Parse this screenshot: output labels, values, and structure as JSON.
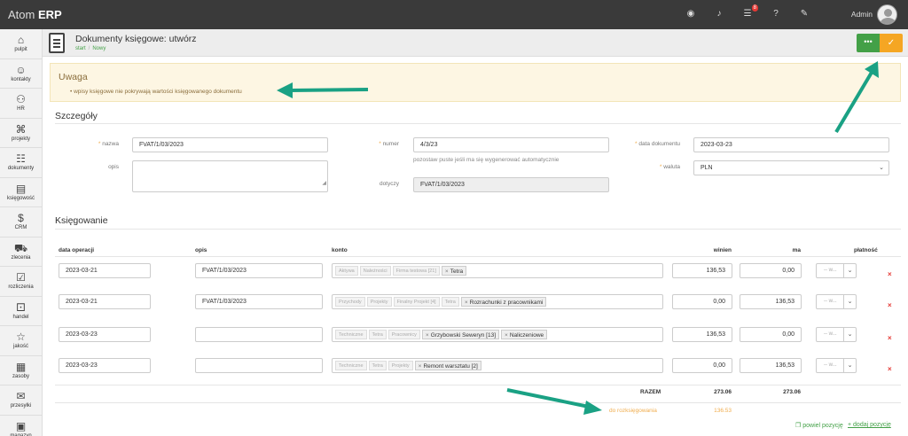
{
  "app": {
    "brand_light": "Atom",
    "brand_bold": "ERP",
    "user": "Admin",
    "notification_count": "8"
  },
  "header": {
    "title": "Dokumenty księgowe: utwórz",
    "breadcrumb": [
      "start",
      "Nowy"
    ],
    "more_label": "•••",
    "save_icon": "✓"
  },
  "sidebar": [
    {
      "label": "pulpit",
      "icon": "home-icon",
      "glyph": "⌂"
    },
    {
      "label": "kontakty",
      "icon": "contacts-icon",
      "glyph": "☺"
    },
    {
      "label": "HR",
      "icon": "users-icon",
      "glyph": "⚇"
    },
    {
      "label": "projekty",
      "icon": "projects-icon",
      "glyph": "⌘"
    },
    {
      "label": "dokumenty",
      "icon": "document-icon",
      "glyph": "☷"
    },
    {
      "label": "księgowość",
      "icon": "ledger-icon",
      "glyph": "▤"
    },
    {
      "label": "CRM",
      "icon": "dollar-icon",
      "glyph": "$"
    },
    {
      "label": "zlecenia",
      "icon": "truck-icon",
      "glyph": "⛟"
    },
    {
      "label": "rozliczenia",
      "icon": "checklist-icon",
      "glyph": "☑"
    },
    {
      "label": "handel",
      "icon": "basket-icon",
      "glyph": "⚀"
    },
    {
      "label": "jakość",
      "icon": "star-icon",
      "glyph": "☆"
    },
    {
      "label": "zasoby",
      "icon": "archive-icon",
      "glyph": "▦"
    },
    {
      "label": "przesyłki",
      "icon": "mail-icon",
      "glyph": "✉"
    },
    {
      "label": "magazyn",
      "icon": "boxes-icon",
      "glyph": "▣"
    }
  ],
  "alert": {
    "title": "Uwaga",
    "item": "wpisy księgowe nie pokrywają wartości księgowanego dokumentu"
  },
  "details": {
    "title": "Szczegóły",
    "nazwa_label": "nazwa",
    "nazwa_value": "FVAT/1/03/2023",
    "opis_label": "opis",
    "numer_label": "numer",
    "numer_value": "4/3/23",
    "numer_hint": "pozostaw puste jeśli ma się wygenerować automatycznie",
    "dotyczy_label": "dotyczy",
    "dotyczy_value": "FVAT/1/03/2023",
    "data_label": "data dokumentu",
    "data_value": "2023-03-23",
    "waluta_label": "waluta",
    "waluta_value": "PLN"
  },
  "postings": {
    "title": "Księgowanie",
    "headers": {
      "data": "data operacji",
      "opis": "opis",
      "konto": "konto",
      "winien": "winien",
      "ma": "ma",
      "platnosc": "płatność"
    },
    "pay_placeholder": "-- w...",
    "rows": [
      {
        "date": "2023-03-21",
        "opis": "FVAT/1/03/2023",
        "tags_disabled": [
          "Aktywa",
          "Należności",
          "Firma testowa [21]"
        ],
        "tags": [
          "Tetra"
        ],
        "winien": "136,53",
        "ma": "0,00"
      },
      {
        "date": "2023-03-21",
        "opis": "FVAT/1/03/2023",
        "tags_disabled": [
          "Przychody",
          "Projekty",
          "Finalny Projekt [4]",
          "Tetra"
        ],
        "tags": [
          "Rozrachunki z pracownikami"
        ],
        "winien": "0,00",
        "ma": "136,53"
      },
      {
        "date": "2023-03-23",
        "opis": "",
        "tags_disabled": [
          "Techniczne",
          "Tetra",
          "Pracownicy"
        ],
        "tags": [
          "Grzybowski Seweryn [13]",
          "Naliczeniowe"
        ],
        "winien": "136,53",
        "ma": "0,00"
      },
      {
        "date": "2023-03-23",
        "opis": "",
        "tags_disabled": [
          "Techniczne",
          "Tetra",
          "Projekty"
        ],
        "tags": [
          "Remont warsztatu [2]"
        ],
        "winien": "0,00",
        "ma": "136,53"
      }
    ],
    "razem_label": "RAZEM",
    "razem_winien": "273.06",
    "razem_ma": "273.06",
    "do_label": "do rozksięgowania",
    "do_value": "136.53",
    "repeat_label": "powiel pozycję",
    "add_label": "+ dodaj pozycję"
  },
  "colors": {
    "accent_green": "#43a047",
    "accent_orange": "#f5a623",
    "annotation_arrow": "#1aa184"
  }
}
